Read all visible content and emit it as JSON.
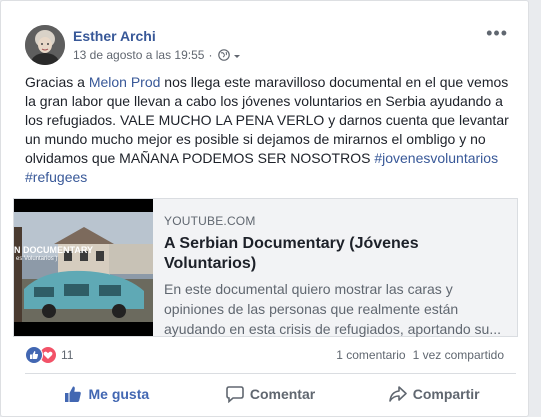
{
  "post": {
    "author": "Esther Archi",
    "date": "13 de agosto a las 19:55",
    "separator": "·",
    "more_label": "•••",
    "text": {
      "part1": "Gracias a ",
      "mention": "Melon Prod",
      "part2": " nos llega este maravilloso documental en el que vemos la gran labor que llevan a cabo los jóvenes voluntarios en Serbia ayudando a los refugiados. VALE MUCHO LA PENA VERLO y darnos cuenta que levantar un mundo mucho mejor es posible si dejamos de mirarnos el ombligo y no olvidamos que MAÑANA PODEMOS SER NOSOTROS",
      "hashtag1": "#jovenesvoluntarios",
      "hashtag2": "#refugees"
    },
    "link_card": {
      "domain": "YOUTUBE.COM",
      "title": "A Serbian Documentary (Jóvenes Voluntarios)",
      "description": "En este documental quiero mostrar las caras y opiniones de las personas que realmente están ayudando en esta crisis de refugiados, aportando su...",
      "thumb_caption1": "N DOCUMENTARY",
      "thumb_caption2": "es Voluntarios )"
    },
    "reactions": {
      "count": "11",
      "comments": "1 comentario",
      "shares": "1 vez compartido",
      "types": [
        "like-icon",
        "love-icon"
      ]
    },
    "actions": {
      "like": "Me gusta",
      "comment": "Comentar",
      "share": "Compartir"
    }
  },
  "colors": {
    "link": "#385898",
    "like_blue": "#4267b2",
    "love_red": "#f25268",
    "secondary_text": "#606770"
  }
}
